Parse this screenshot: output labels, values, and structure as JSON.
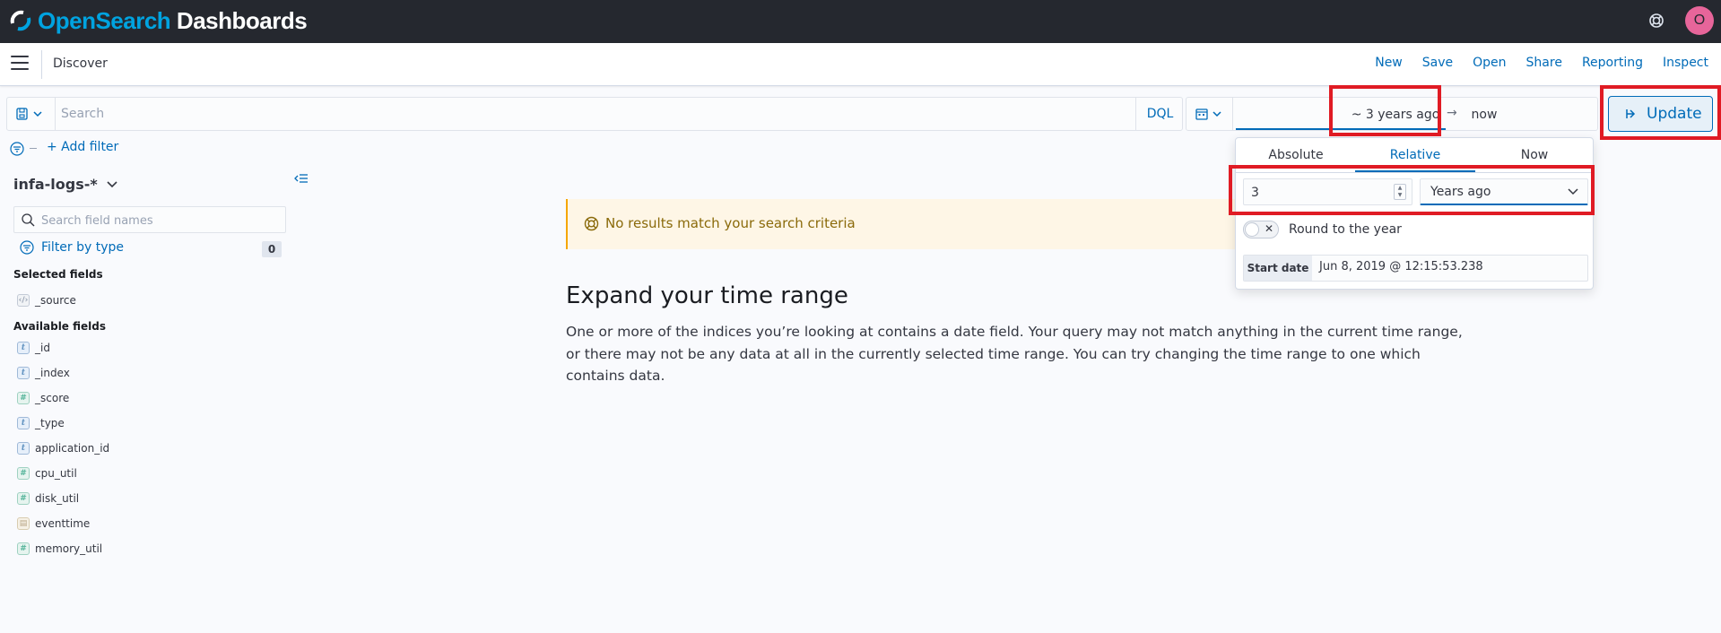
{
  "app": {
    "logo_open": "Open",
    "logo_search": "Search",
    "logo_dashboards": " Dashboards",
    "user_initial": "O"
  },
  "header": {
    "page_title": "Discover",
    "menu": [
      "New",
      "Save",
      "Open",
      "Share",
      "Reporting",
      "Inspect"
    ]
  },
  "query": {
    "placeholder": "Search",
    "language": "DQL",
    "add_filter": "+ Add filter"
  },
  "time": {
    "start": "~ 3 years ago",
    "end": "now",
    "update_label": "Update"
  },
  "popover": {
    "tabs": [
      "Absolute",
      "Relative",
      "Now"
    ],
    "active_tab": "Relative",
    "amount": "3",
    "unit": "Years ago",
    "round_label": "Round to the year",
    "start_date_label": "Start date",
    "start_date_value": "Jun 8, 2019 @ 12:15:53.238"
  },
  "sidebar": {
    "index_pattern": "infa-logs-*",
    "field_search_placeholder": "Search field names",
    "filter_by_type": "Filter by type",
    "filter_count": "0",
    "selected_title": "Selected fields",
    "selected_fields": [
      {
        "type": "source",
        "name": "_source"
      }
    ],
    "available_title": "Available fields",
    "available_fields": [
      {
        "type": "t",
        "name": "_id"
      },
      {
        "type": "t",
        "name": "_index"
      },
      {
        "type": "#",
        "name": "_score"
      },
      {
        "type": "t",
        "name": "_type"
      },
      {
        "type": "t",
        "name": "application_id"
      },
      {
        "type": "#",
        "name": "cpu_util"
      },
      {
        "type": "#",
        "name": "disk_util"
      },
      {
        "type": "date",
        "name": "eventtime"
      },
      {
        "type": "#",
        "name": "memory_util"
      }
    ]
  },
  "main": {
    "callout": "No results match your search criteria",
    "title": "Expand your time range",
    "body": "One or more of the indices you’re looking at contains a date field. Your query may not match anything in the current time range, or there may not be any data at all in the currently selected time range. You can try changing the time range to one which contains data."
  }
}
